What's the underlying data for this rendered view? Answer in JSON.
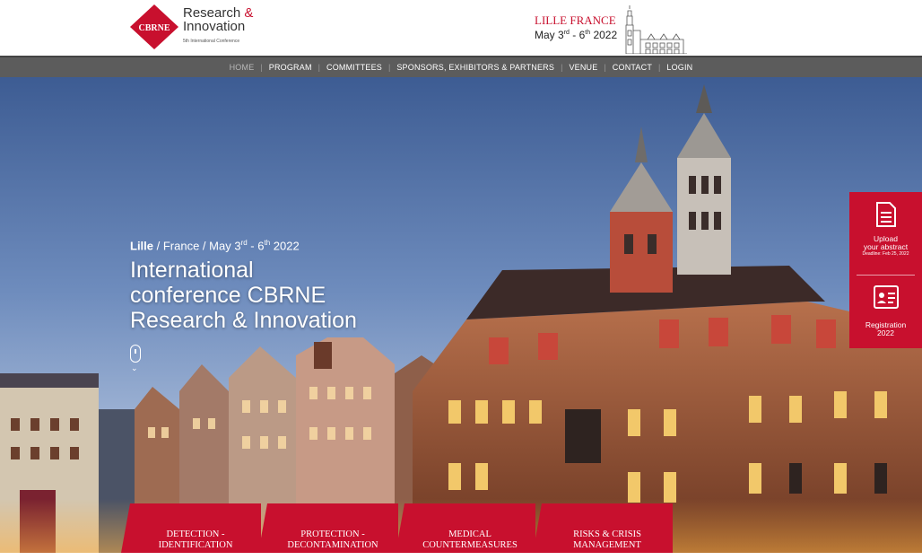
{
  "header": {
    "logo_badge": "CBRNE",
    "logo_line1": "Research",
    "logo_amp": "&",
    "logo_line2": "Innovation",
    "logo_sub": "5th International Conference",
    "event_city": "LILLE FRANCE",
    "event_date_start": "May 3",
    "event_date_start_sup": "rd",
    "event_date_sep": " - 6",
    "event_date_end_sup": "th",
    "event_date_year": " 2022"
  },
  "nav": {
    "items": [
      "HOME",
      "PROGRAM",
      "COMMITTEES",
      "SPONSORS, EXHIBITORS & PARTNERS",
      "VENUE",
      "CONTACT",
      "LOGIN"
    ]
  },
  "hero": {
    "meta_city": "Lille",
    "meta_rest": " / France / May 3",
    "meta_sup1": "rd",
    "meta_mid": " - 6",
    "meta_sup2": "th",
    "meta_year": " 2022",
    "title_line1": "International",
    "title_line2": "conference CBRNE",
    "title_line3": "Research & Innovation"
  },
  "side_panel": {
    "upload_line1": "Upload",
    "upload_line2": "your abstract",
    "upload_deadline": "Deadline: Feb 25, 2022",
    "registration_line1": "Registration",
    "registration_line2": "2022"
  },
  "tabs": [
    {
      "line1": "DETECTION -",
      "line2": "IDENTIFICATION"
    },
    {
      "line1": "PROTECTION -",
      "line2": "DECONTAMINATION"
    },
    {
      "line1": "MEDICAL",
      "line2": "COUNTERMEASURES"
    },
    {
      "line1": "RISKS & CRISIS",
      "line2": "MANAGEMENT"
    }
  ],
  "colors": {
    "brand": "#c8102e",
    "nav": "#5c5c5c"
  }
}
